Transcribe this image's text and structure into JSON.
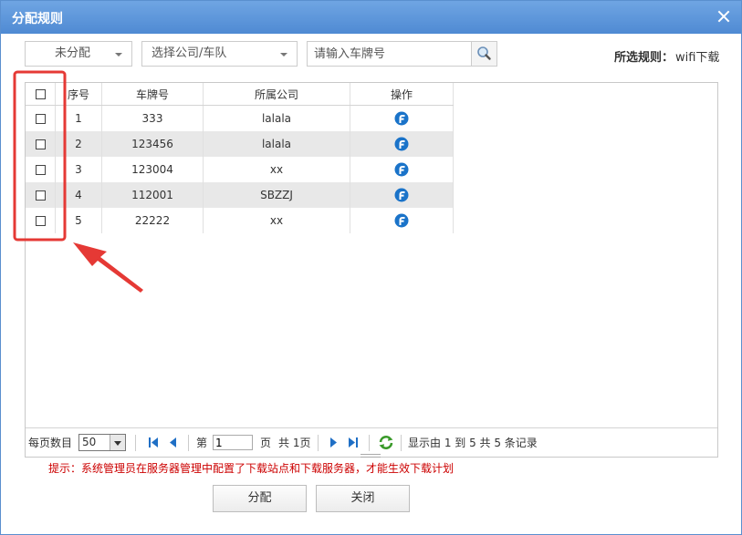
{
  "dialog": {
    "title": "分配规则"
  },
  "filters": {
    "status_selected": "未分配",
    "company_placeholder": "选择公司/车队",
    "plate_placeholder": "请输入车牌号",
    "rule_label": "所选规则：",
    "rule_value": "wifi下载"
  },
  "table": {
    "headers": {
      "index": "序号",
      "plate": "车牌号",
      "company": "所属公司",
      "action": "操作"
    },
    "rows": [
      {
        "index": "1",
        "plate": "333",
        "company": "lalala"
      },
      {
        "index": "2",
        "plate": "123456",
        "company": "lalala"
      },
      {
        "index": "3",
        "plate": "123004",
        "company": "xx"
      },
      {
        "index": "4",
        "plate": "112001",
        "company": "SBZZJ"
      },
      {
        "index": "5",
        "plate": "22222",
        "company": "xx"
      }
    ]
  },
  "pager": {
    "page_size_label": "每页数目",
    "page_size": "50",
    "page_prefix": "第",
    "current_page": "1",
    "page_suffix": "页",
    "total_pages": "共 1页",
    "summary": "显示由 1 到 5 共 5 条记录"
  },
  "hint": "提示：系统管理员在服务器管理中配置了下载站点和下载服务器，才能生效下载计划",
  "buttons": {
    "assign": "分配",
    "close": "关闭"
  },
  "colors": {
    "titlebar": "#5f98da",
    "annotation": "#e53935",
    "hint": "#cc0000"
  }
}
